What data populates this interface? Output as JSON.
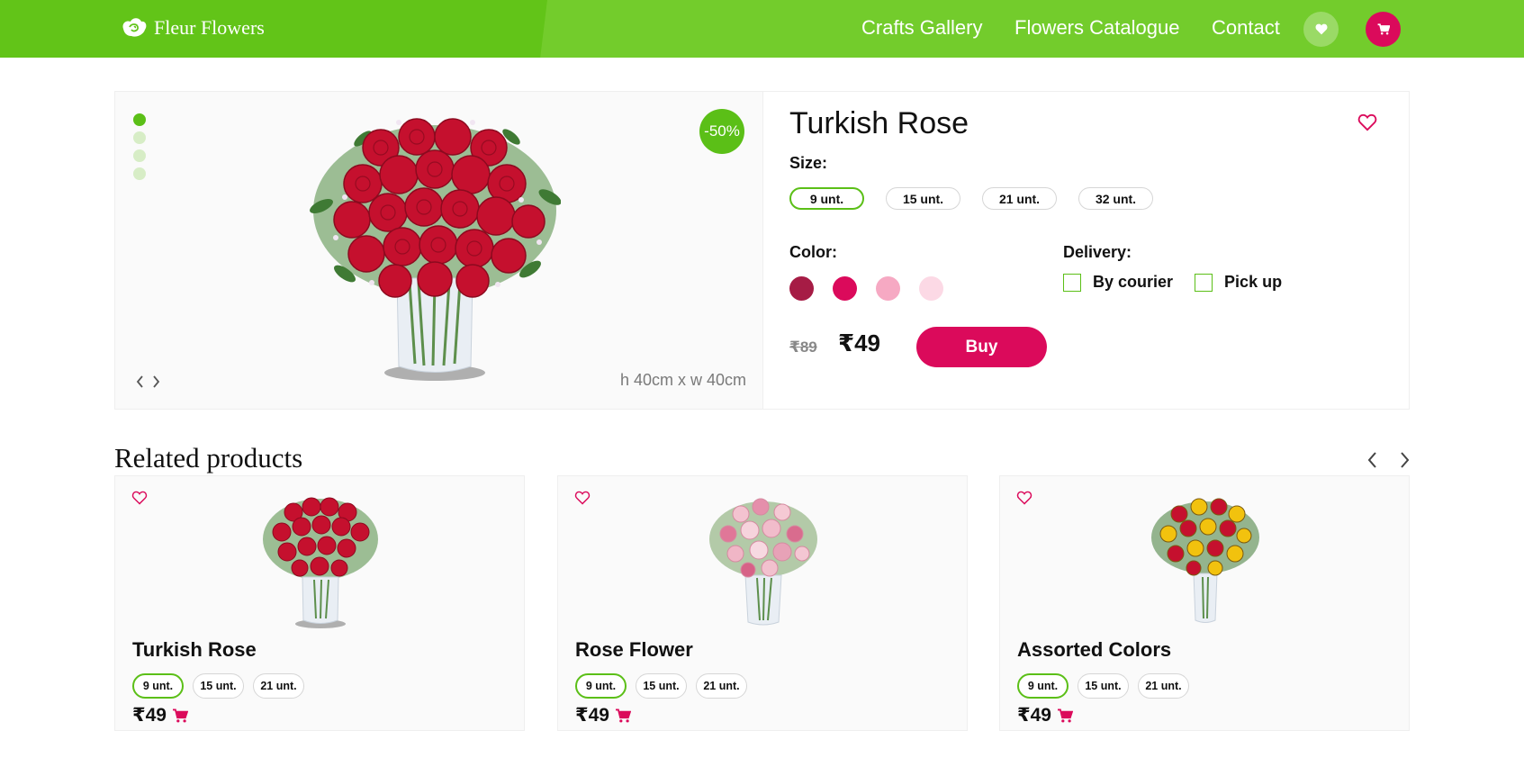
{
  "header": {
    "brand": "Fleur Flowers",
    "nav": [
      "Crafts Gallery",
      "Flowers Catalogue",
      "Contact"
    ],
    "icons": {
      "logo": "rose-logo-icon",
      "favorites": "heart-icon",
      "cart": "cart-icon"
    }
  },
  "colors": {
    "header_green": "#62c418",
    "accent_green": "#5bbf17",
    "accent_pink": "#db0a5b"
  },
  "product": {
    "discount": "-50%",
    "dimensions": "h 40cm x w 40cm",
    "title": "Turkish Rose",
    "size_label": "Size:",
    "sizes": [
      "9 unt.",
      "15 unt.",
      "21 unt.",
      "32 unt."
    ],
    "selected_size": "9 unt.",
    "color_label": "Color:",
    "swatches": [
      "#a61c45",
      "#db0a5b",
      "#f6a9c3",
      "#fcd9e5"
    ],
    "delivery_label": "Delivery:",
    "delivery_options": [
      "By courier",
      "Pick up"
    ],
    "old_price": "₹89",
    "price": "₹49",
    "buy_label": "Buy",
    "gallery_images": 4
  },
  "related": {
    "title": "Related products",
    "cards": [
      {
        "title": "Turkish Rose",
        "sizes": [
          "9 unt.",
          "15 unt.",
          "21 unt."
        ],
        "price": "₹49"
      },
      {
        "title": "Rose Flower",
        "sizes": [
          "9 unt.",
          "15 unt.",
          "21 unt."
        ],
        "price": "₹49"
      },
      {
        "title": "Assorted Colors",
        "sizes": [
          "9 unt.",
          "15 unt.",
          "21 unt."
        ],
        "price": "₹49"
      }
    ]
  }
}
